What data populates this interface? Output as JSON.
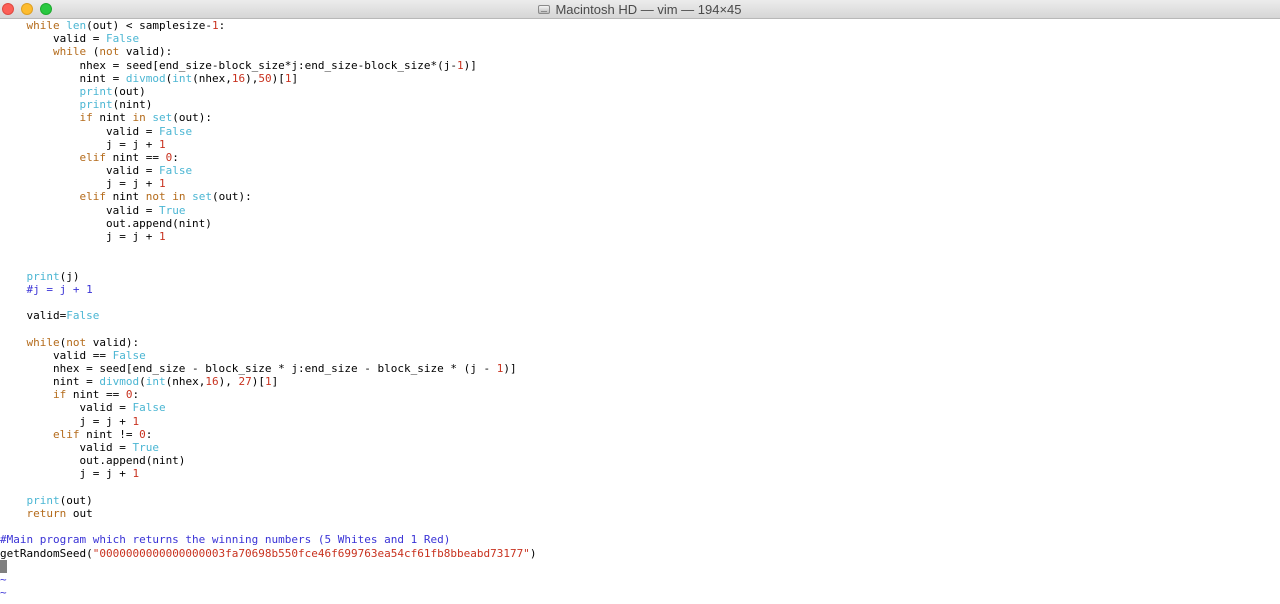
{
  "window": {
    "title": "Macintosh HD — vim — 194×45",
    "title_icon": "hard-disk-icon",
    "colors": {
      "close": "#fc5f57",
      "minimize": "#fdbc2e",
      "maximize": "#29c840"
    }
  },
  "editor": {
    "syntax_colors": {
      "keyword": "#b46b1b",
      "builtin": "#4bb6d3",
      "number": "#c8321f",
      "string": "#c8321f",
      "comment": "#3a33d6"
    },
    "lines": [
      [
        {
          "t": "    "
        },
        {
          "t": "while",
          "c": "kw"
        },
        {
          "t": " "
        },
        {
          "t": "len",
          "c": "bi"
        },
        {
          "t": "(out) < samplesize-"
        },
        {
          "t": "1",
          "c": "num"
        },
        {
          "t": ":"
        }
      ],
      [
        {
          "t": "        valid = "
        },
        {
          "t": "False",
          "c": "bi"
        }
      ],
      [
        {
          "t": "        "
        },
        {
          "t": "while",
          "c": "kw"
        },
        {
          "t": " ("
        },
        {
          "t": "not",
          "c": "kw"
        },
        {
          "t": " valid):"
        }
      ],
      [
        {
          "t": "            nhex = seed[end_size-block_size*j:end_size-block_size*(j-"
        },
        {
          "t": "1",
          "c": "num"
        },
        {
          "t": ")]"
        }
      ],
      [
        {
          "t": "            nint = "
        },
        {
          "t": "divmod",
          "c": "bi"
        },
        {
          "t": "("
        },
        {
          "t": "int",
          "c": "bi"
        },
        {
          "t": "(nhex,"
        },
        {
          "t": "16",
          "c": "num"
        },
        {
          "t": "),"
        },
        {
          "t": "50",
          "c": "num"
        },
        {
          "t": ")["
        },
        {
          "t": "1",
          "c": "num"
        },
        {
          "t": "]"
        }
      ],
      [
        {
          "t": "            "
        },
        {
          "t": "print",
          "c": "bi"
        },
        {
          "t": "(out)"
        }
      ],
      [
        {
          "t": "            "
        },
        {
          "t": "print",
          "c": "bi"
        },
        {
          "t": "(nint)"
        }
      ],
      [
        {
          "t": "            "
        },
        {
          "t": "if",
          "c": "kw"
        },
        {
          "t": " nint "
        },
        {
          "t": "in",
          "c": "kw"
        },
        {
          "t": " "
        },
        {
          "t": "set",
          "c": "bi"
        },
        {
          "t": "(out):"
        }
      ],
      [
        {
          "t": "                valid = "
        },
        {
          "t": "False",
          "c": "bi"
        }
      ],
      [
        {
          "t": "                j = j + "
        },
        {
          "t": "1",
          "c": "num"
        }
      ],
      [
        {
          "t": "            "
        },
        {
          "t": "elif",
          "c": "kw"
        },
        {
          "t": " nint == "
        },
        {
          "t": "0",
          "c": "num"
        },
        {
          "t": ":"
        }
      ],
      [
        {
          "t": "                valid = "
        },
        {
          "t": "False",
          "c": "bi"
        }
      ],
      [
        {
          "t": "                j = j + "
        },
        {
          "t": "1",
          "c": "num"
        }
      ],
      [
        {
          "t": "            "
        },
        {
          "t": "elif",
          "c": "kw"
        },
        {
          "t": " nint "
        },
        {
          "t": "not",
          "c": "kw"
        },
        {
          "t": " "
        },
        {
          "t": "in",
          "c": "kw"
        },
        {
          "t": " "
        },
        {
          "t": "set",
          "c": "bi"
        },
        {
          "t": "(out):"
        }
      ],
      [
        {
          "t": "                valid = "
        },
        {
          "t": "True",
          "c": "bi"
        }
      ],
      [
        {
          "t": "                out.append(nint)"
        }
      ],
      [
        {
          "t": "                j = j + "
        },
        {
          "t": "1",
          "c": "num"
        }
      ],
      [],
      [],
      [
        {
          "t": "    "
        },
        {
          "t": "print",
          "c": "bi"
        },
        {
          "t": "(j)"
        }
      ],
      [
        {
          "t": "    #j = j + 1",
          "c": "cmt"
        }
      ],
      [],
      [
        {
          "t": "    valid="
        },
        {
          "t": "False",
          "c": "bi"
        }
      ],
      [],
      [
        {
          "t": "    "
        },
        {
          "t": "while",
          "c": "kw"
        },
        {
          "t": "("
        },
        {
          "t": "not",
          "c": "kw"
        },
        {
          "t": " valid):"
        }
      ],
      [
        {
          "t": "        valid == "
        },
        {
          "t": "False",
          "c": "bi"
        }
      ],
      [
        {
          "t": "        nhex = seed[end_size - block_size * j:end_size - block_size * (j - "
        },
        {
          "t": "1",
          "c": "num"
        },
        {
          "t": ")]"
        }
      ],
      [
        {
          "t": "        nint = "
        },
        {
          "t": "divmod",
          "c": "bi"
        },
        {
          "t": "("
        },
        {
          "t": "int",
          "c": "bi"
        },
        {
          "t": "(nhex,"
        },
        {
          "t": "16",
          "c": "num"
        },
        {
          "t": "), "
        },
        {
          "t": "27",
          "c": "num"
        },
        {
          "t": ")["
        },
        {
          "t": "1",
          "c": "num"
        },
        {
          "t": "]"
        }
      ],
      [
        {
          "t": "        "
        },
        {
          "t": "if",
          "c": "kw"
        },
        {
          "t": " nint == "
        },
        {
          "t": "0",
          "c": "num"
        },
        {
          "t": ":"
        }
      ],
      [
        {
          "t": "            valid = "
        },
        {
          "t": "False",
          "c": "bi"
        }
      ],
      [
        {
          "t": "            j = j + "
        },
        {
          "t": "1",
          "c": "num"
        }
      ],
      [
        {
          "t": "        "
        },
        {
          "t": "elif",
          "c": "kw"
        },
        {
          "t": " nint != "
        },
        {
          "t": "0",
          "c": "num"
        },
        {
          "t": ":"
        }
      ],
      [
        {
          "t": "            valid = "
        },
        {
          "t": "True",
          "c": "bi"
        }
      ],
      [
        {
          "t": "            out.append(nint)"
        }
      ],
      [
        {
          "t": "            j = j + "
        },
        {
          "t": "1",
          "c": "num"
        }
      ],
      [],
      [
        {
          "t": "    "
        },
        {
          "t": "print",
          "c": "bi"
        },
        {
          "t": "(out)"
        }
      ],
      [
        {
          "t": "    "
        },
        {
          "t": "return",
          "c": "kw"
        },
        {
          "t": " out"
        }
      ],
      [],
      [
        {
          "t": "#Main program which returns the winning numbers (5 Whites and 1 Red)",
          "c": "cmt"
        }
      ],
      [
        {
          "t": "getRandomSeed("
        },
        {
          "t": "\"0000000000000000003fa70698b550fce46f699763ea54cf61fb8bbeabd73177\"",
          "c": "str"
        },
        {
          "t": ")"
        }
      ],
      [
        {
          "t": " ",
          "c": "cursor"
        }
      ],
      [
        {
          "t": "~",
          "c": "tilde"
        }
      ],
      [
        {
          "t": "~",
          "c": "tilde"
        }
      ]
    ]
  }
}
